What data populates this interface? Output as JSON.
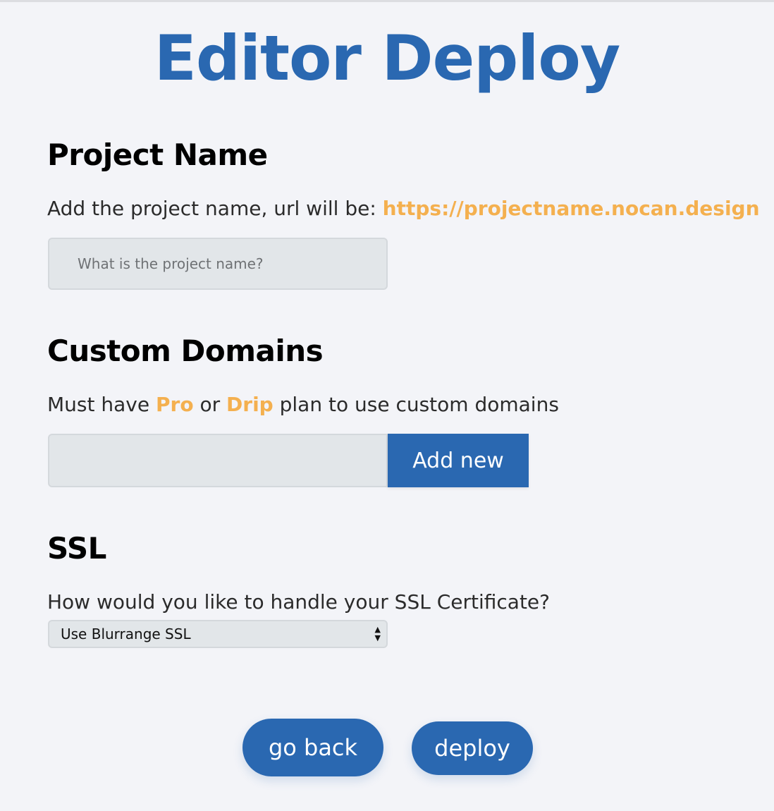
{
  "app": {
    "title": "Editor Deploy"
  },
  "project": {
    "heading": "Project Name",
    "desc_prefix": "Add the project name, url will be: ",
    "url": "https://projectname.nocan.design",
    "input_placeholder": "What is the project name?",
    "input_value": ""
  },
  "domains": {
    "heading": "Custom Domains",
    "desc_prefix": "Must have ",
    "plan_pro": "Pro",
    "desc_or": " or ",
    "plan_drip": "Drip",
    "desc_suffix": " plan to use custom domains",
    "input_value": "",
    "add_label": "Add new"
  },
  "ssl": {
    "heading": "SSL",
    "desc": "How would you like to handle your SSL Certificate?",
    "selected": "Use Blurrange SSL"
  },
  "actions": {
    "back_label": "go back",
    "deploy_label": "deploy"
  },
  "colors": {
    "brand": "#2a68b1",
    "highlight": "#f4b04f",
    "background": "#f3f4f8",
    "input_bg": "#e2e6e9"
  },
  "icons": {
    "select_arrows": "chevron-up-down-icon"
  }
}
